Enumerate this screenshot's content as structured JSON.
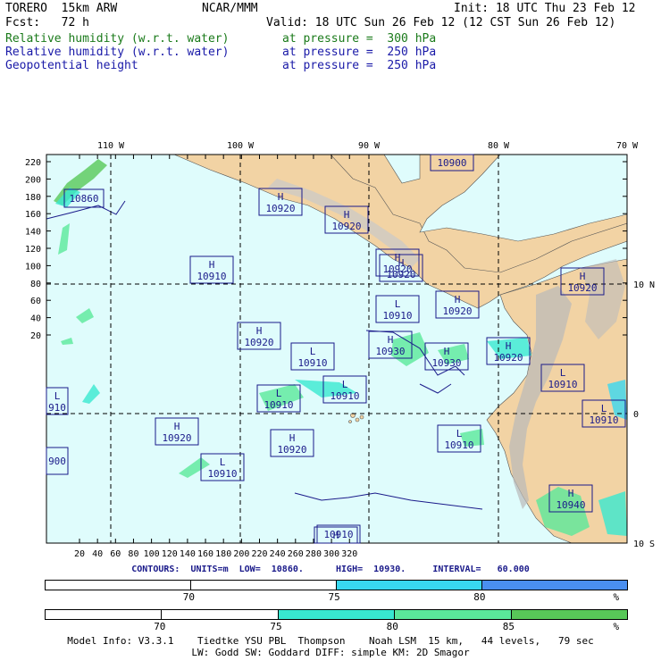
{
  "header": {
    "model": "TORERO  15km ARW",
    "org": "NCAR/MMM",
    "init": "Init: 18 UTC Thu 23 Feb 12",
    "fcst": "Fcst:   72 h",
    "valid": "Valid: 18 UTC Sun 26 Feb 12 (12 CST Sun 26 Feb 12)",
    "fields": [
      {
        "name": "Relative humidity (w.r.t. water)",
        "level": "at pressure =  300 hPa",
        "color": "#1a7a1a"
      },
      {
        "name": "Relative humidity (w.r.t. water)",
        "level": "at pressure =  250 hPa",
        "color": "#1a1aa8"
      },
      {
        "name": "Geopotential height",
        "level": "at pressure =  250 hPa",
        "color": "#1a1aa8"
      }
    ]
  },
  "map": {
    "top_lon_labels": [
      "110 W",
      "100 W",
      "90 W",
      "80 W",
      "70 W"
    ],
    "right_lat_labels": [
      "10 N",
      "0",
      "10 S"
    ],
    "left_y_ticks": [
      "220",
      "200",
      "180",
      "160",
      "140",
      "120",
      "100",
      "80",
      "60",
      "40",
      "20"
    ],
    "bottom_x_ticks": [
      "20",
      "40",
      "60",
      "80",
      "100",
      "120",
      "140",
      "160",
      "180",
      "200",
      "220",
      "240",
      "260",
      "280",
      "300",
      "320"
    ],
    "ocean_color": "#dffcfc",
    "land_color": "#f2d3a4",
    "highs_lows": [
      {
        "type": "L",
        "value": "10860",
        "label_only": true
      },
      {
        "type": "H",
        "value": "10920"
      },
      {
        "type": "H",
        "value": "10920"
      },
      {
        "type": "",
        "value": "10900",
        "label_only": true
      },
      {
        "type": "H",
        "value": "10910"
      },
      {
        "type": "H",
        "value": "10920"
      },
      {
        "type": "H",
        "value": "10920"
      },
      {
        "type": "L",
        "value": "10910"
      },
      {
        "type": "H",
        "value": "10920"
      },
      {
        "type": "H",
        "value": "10920"
      },
      {
        "type": "H",
        "value": "10920"
      },
      {
        "type": "L",
        "value": "10910"
      },
      {
        "type": "H",
        "value": "10930"
      },
      {
        "type": "H",
        "value": "10930"
      },
      {
        "type": "H",
        "value": "10920"
      },
      {
        "type": "L",
        "value": "10910"
      },
      {
        "type": "L",
        "value": "10910"
      },
      {
        "type": "L",
        "value": "10910"
      },
      {
        "type": "L",
        "value": "910",
        "label_only": true
      },
      {
        "type": "L",
        "value": "10910"
      },
      {
        "type": "H",
        "value": "10920"
      },
      {
        "type": "H",
        "value": "10920"
      },
      {
        "type": "L",
        "value": "10910"
      },
      {
        "type": "L",
        "value": "10910"
      },
      {
        "type": "",
        "value": "900",
        "label_only": true
      },
      {
        "type": "L",
        "value": "10910"
      },
      {
        "type": "H",
        "value": "10940"
      },
      {
        "type": "H",
        "value": "",
        "label_only": true
      }
    ]
  },
  "contours": {
    "text": "CONTOURS:  UNITS=m  LOW=  10860.      HIGH=  10930.     INTERVAL=   60.000"
  },
  "colorbar_250": {
    "labels": [
      "70",
      "75",
      "80",
      "%"
    ],
    "colors": [
      "#ffffff",
      "#ffffff",
      "#38d8f0",
      "#4a8ff0"
    ]
  },
  "colorbar_300": {
    "labels": [
      "70",
      "75",
      "80",
      "85",
      "%"
    ],
    "colors": [
      "#ffffff",
      "#ffffff",
      "#38e8d0",
      "#5ae89a",
      "#58c858"
    ]
  },
  "footer": {
    "line1": "Model Info: V3.3.1    Tiedtke YSU PBL  Thompson    Noah LSM  15 km,   44 levels,   79 sec",
    "line2": "LW: Godd SW: Goddard DIFF: simple KM: 2D Smagor"
  }
}
